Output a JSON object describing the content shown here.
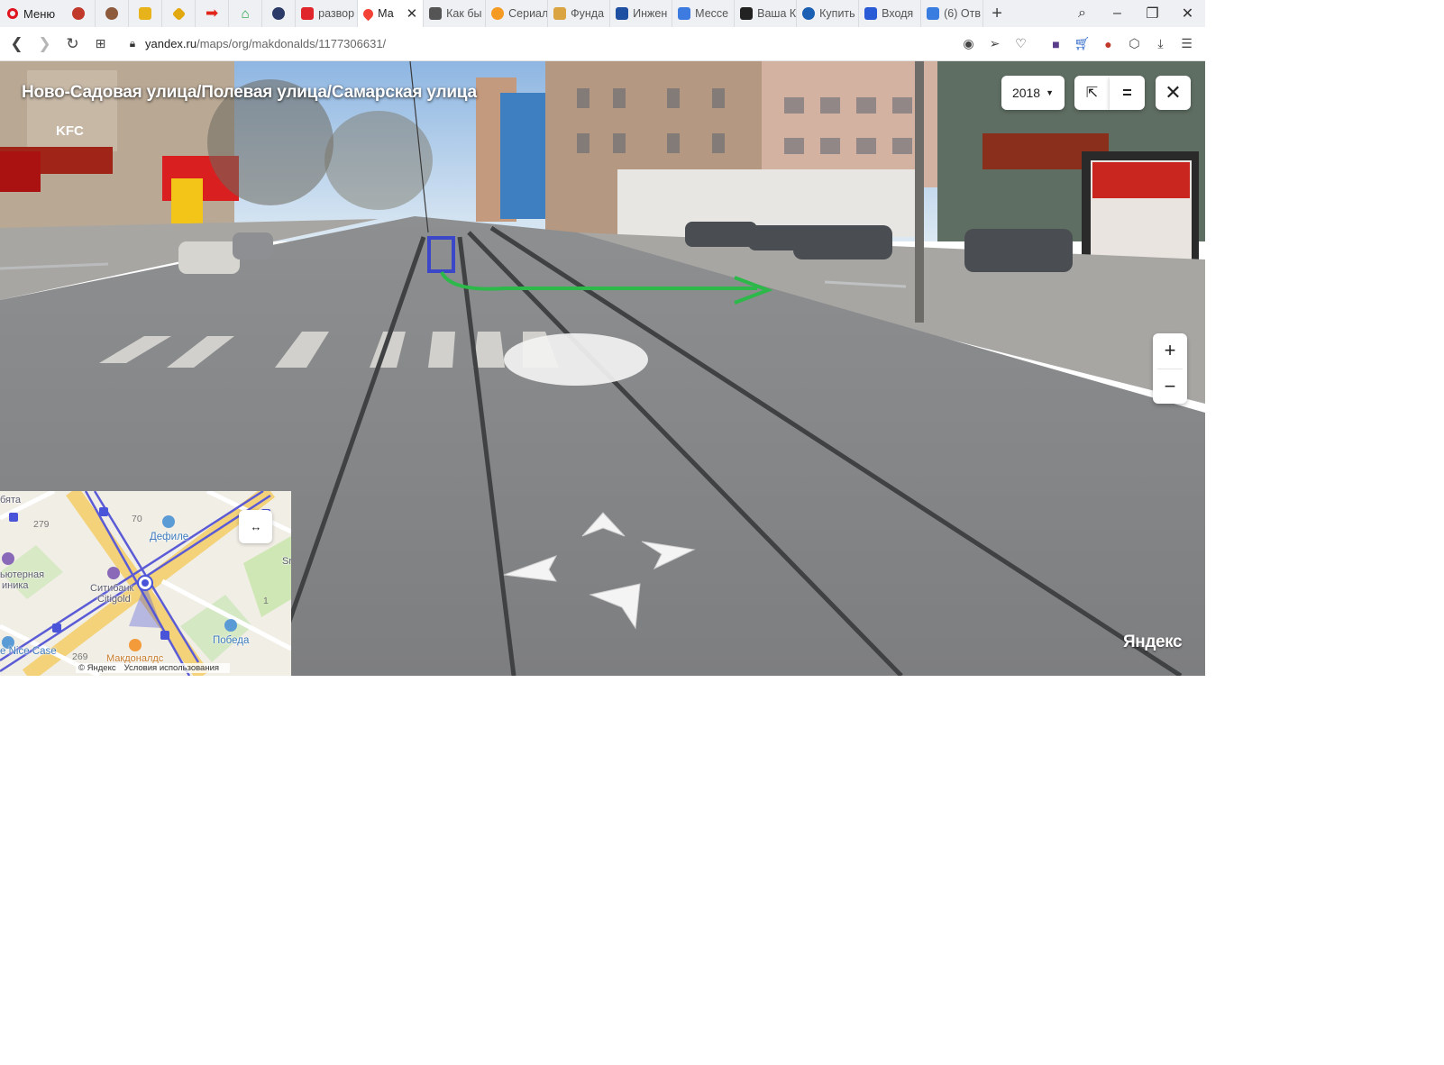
{
  "browser": {
    "menu_label": "Меню",
    "tabs": [
      {
        "label": "развор",
        "color": "#e0262a"
      },
      {
        "label": "Ма",
        "color": "#f44336",
        "active": true
      },
      {
        "label": "Как бы",
        "color": "#555555"
      },
      {
        "label": "Сериал",
        "color": "#f59a23"
      },
      {
        "label": "Фунда",
        "color": "#d9a441"
      },
      {
        "label": "Инжен",
        "color": "#1e4fa0"
      },
      {
        "label": "Мессе",
        "color": "#3d7be0"
      },
      {
        "label": "Ваша К",
        "color": "#222222"
      },
      {
        "label": "Купить",
        "color": "#1a5fb4"
      },
      {
        "label": "Входя",
        "color": "#2a5bd7"
      },
      {
        "label": "(6) Отв",
        "color": "#3a7de0"
      }
    ],
    "url_host": "yandex.ru",
    "url_path": "/maps/org/makdonalds/1177306631/"
  },
  "panorama": {
    "street_title": "Ново-Садовая улица/Полевая улица/Самарская улица",
    "year": "2018",
    "zoom_in": "+",
    "zoom_out": "−",
    "logo": "Яндекс",
    "annotation_color": "#2db84a",
    "marker_color": "#3b46c9"
  },
  "minimap": {
    "labels": {
      "defile": "Дефиле",
      "citibank": "Ситибанк",
      "citigold": "Citigold",
      "pobeda": "Победа",
      "nicecase": "e Nice Case",
      "clinic1": "ьютерная",
      "clinic2": "иника",
      "top": "бята",
      "mcd": "Макдоналдс",
      "edge": "Sr"
    },
    "numbers": {
      "n279": "279",
      "n70": "70",
      "n1": "1",
      "n269": "269"
    },
    "footer_copy": "© Яндекс",
    "footer_terms": "Условия использования",
    "swap_icon": "↔"
  }
}
